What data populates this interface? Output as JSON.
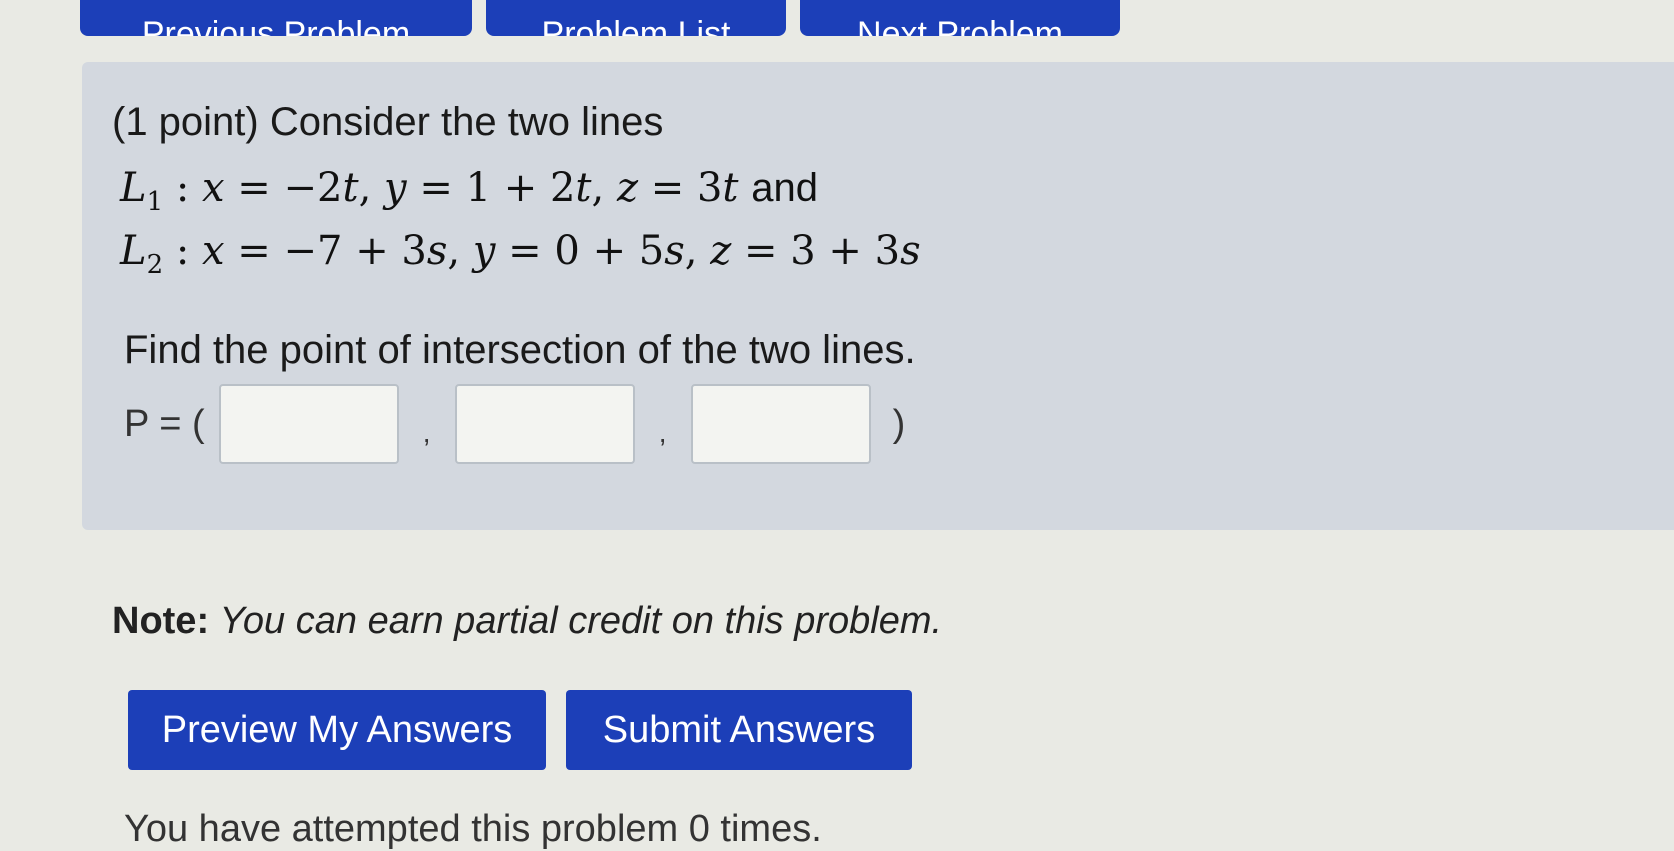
{
  "nav": {
    "previous_label": "Previous Problem",
    "list_label": "Problem List",
    "next_label": "Next Problem"
  },
  "problem": {
    "intro": "(1 point) Consider the two lines",
    "and_word": "and",
    "question": "Find the point of intersection of the two lines.",
    "answer_prefix": "P = (",
    "answer_sep": ",",
    "answer_suffix": ")",
    "answers": [
      "",
      "",
      ""
    ]
  },
  "note": {
    "label": "Note:",
    "text": "You can earn partial credit on this problem."
  },
  "buttons": {
    "preview": "Preview My Answers",
    "submit": "Submit Answers"
  },
  "status": {
    "attempts_text": "You have attempted this problem 0 times."
  },
  "colors": {
    "button_blue": "#1c3fb8",
    "problem_bg": "#d3d8df"
  }
}
